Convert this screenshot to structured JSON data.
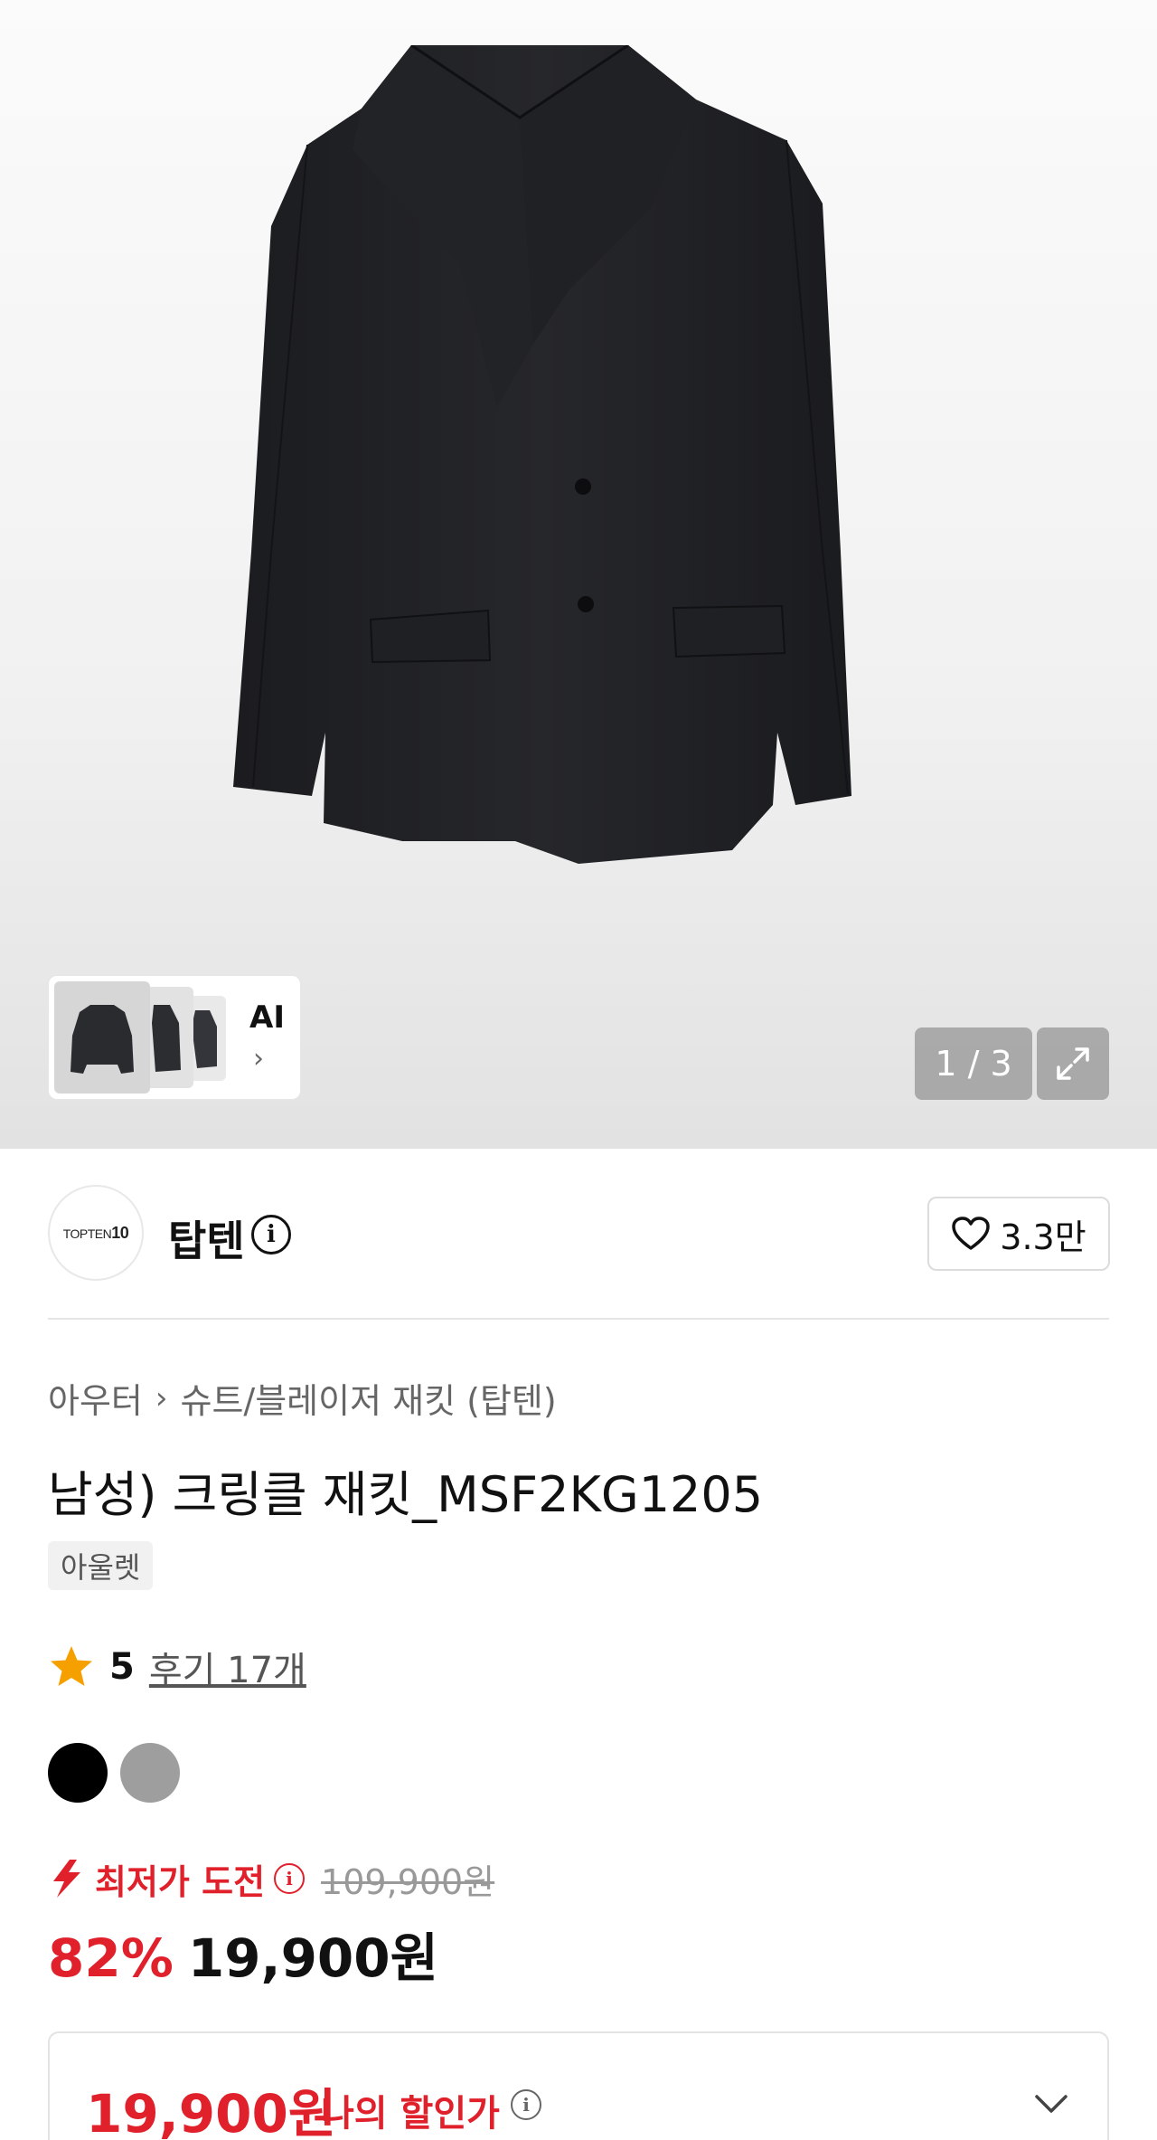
{
  "gallery": {
    "ai_label": "AI",
    "counter": "1 / 3"
  },
  "brand": {
    "logo_text": "TOPTEN",
    "logo_number": "10",
    "name": "탑텐",
    "likes": "3.3만"
  },
  "product": {
    "breadcrumb": [
      "아우터",
      "슈트/블레이저 재킷 (탑텐)"
    ],
    "title": "남성) 크링클 재킷_MSF2KG1205",
    "tag": "아울렛",
    "rating": "5",
    "reviews": "후기 17개",
    "colors": [
      "#000000",
      "#9e9e9e"
    ]
  },
  "pricing": {
    "lowest_label": "최저가 도전",
    "original_price": "109,900원",
    "discount_pct": "82%",
    "sale_price": "19,900원",
    "my_price": "19,900원",
    "my_price_label": "나의 할인가"
  },
  "colors": {
    "accent": "#e0212b",
    "star": "#f6a000"
  }
}
